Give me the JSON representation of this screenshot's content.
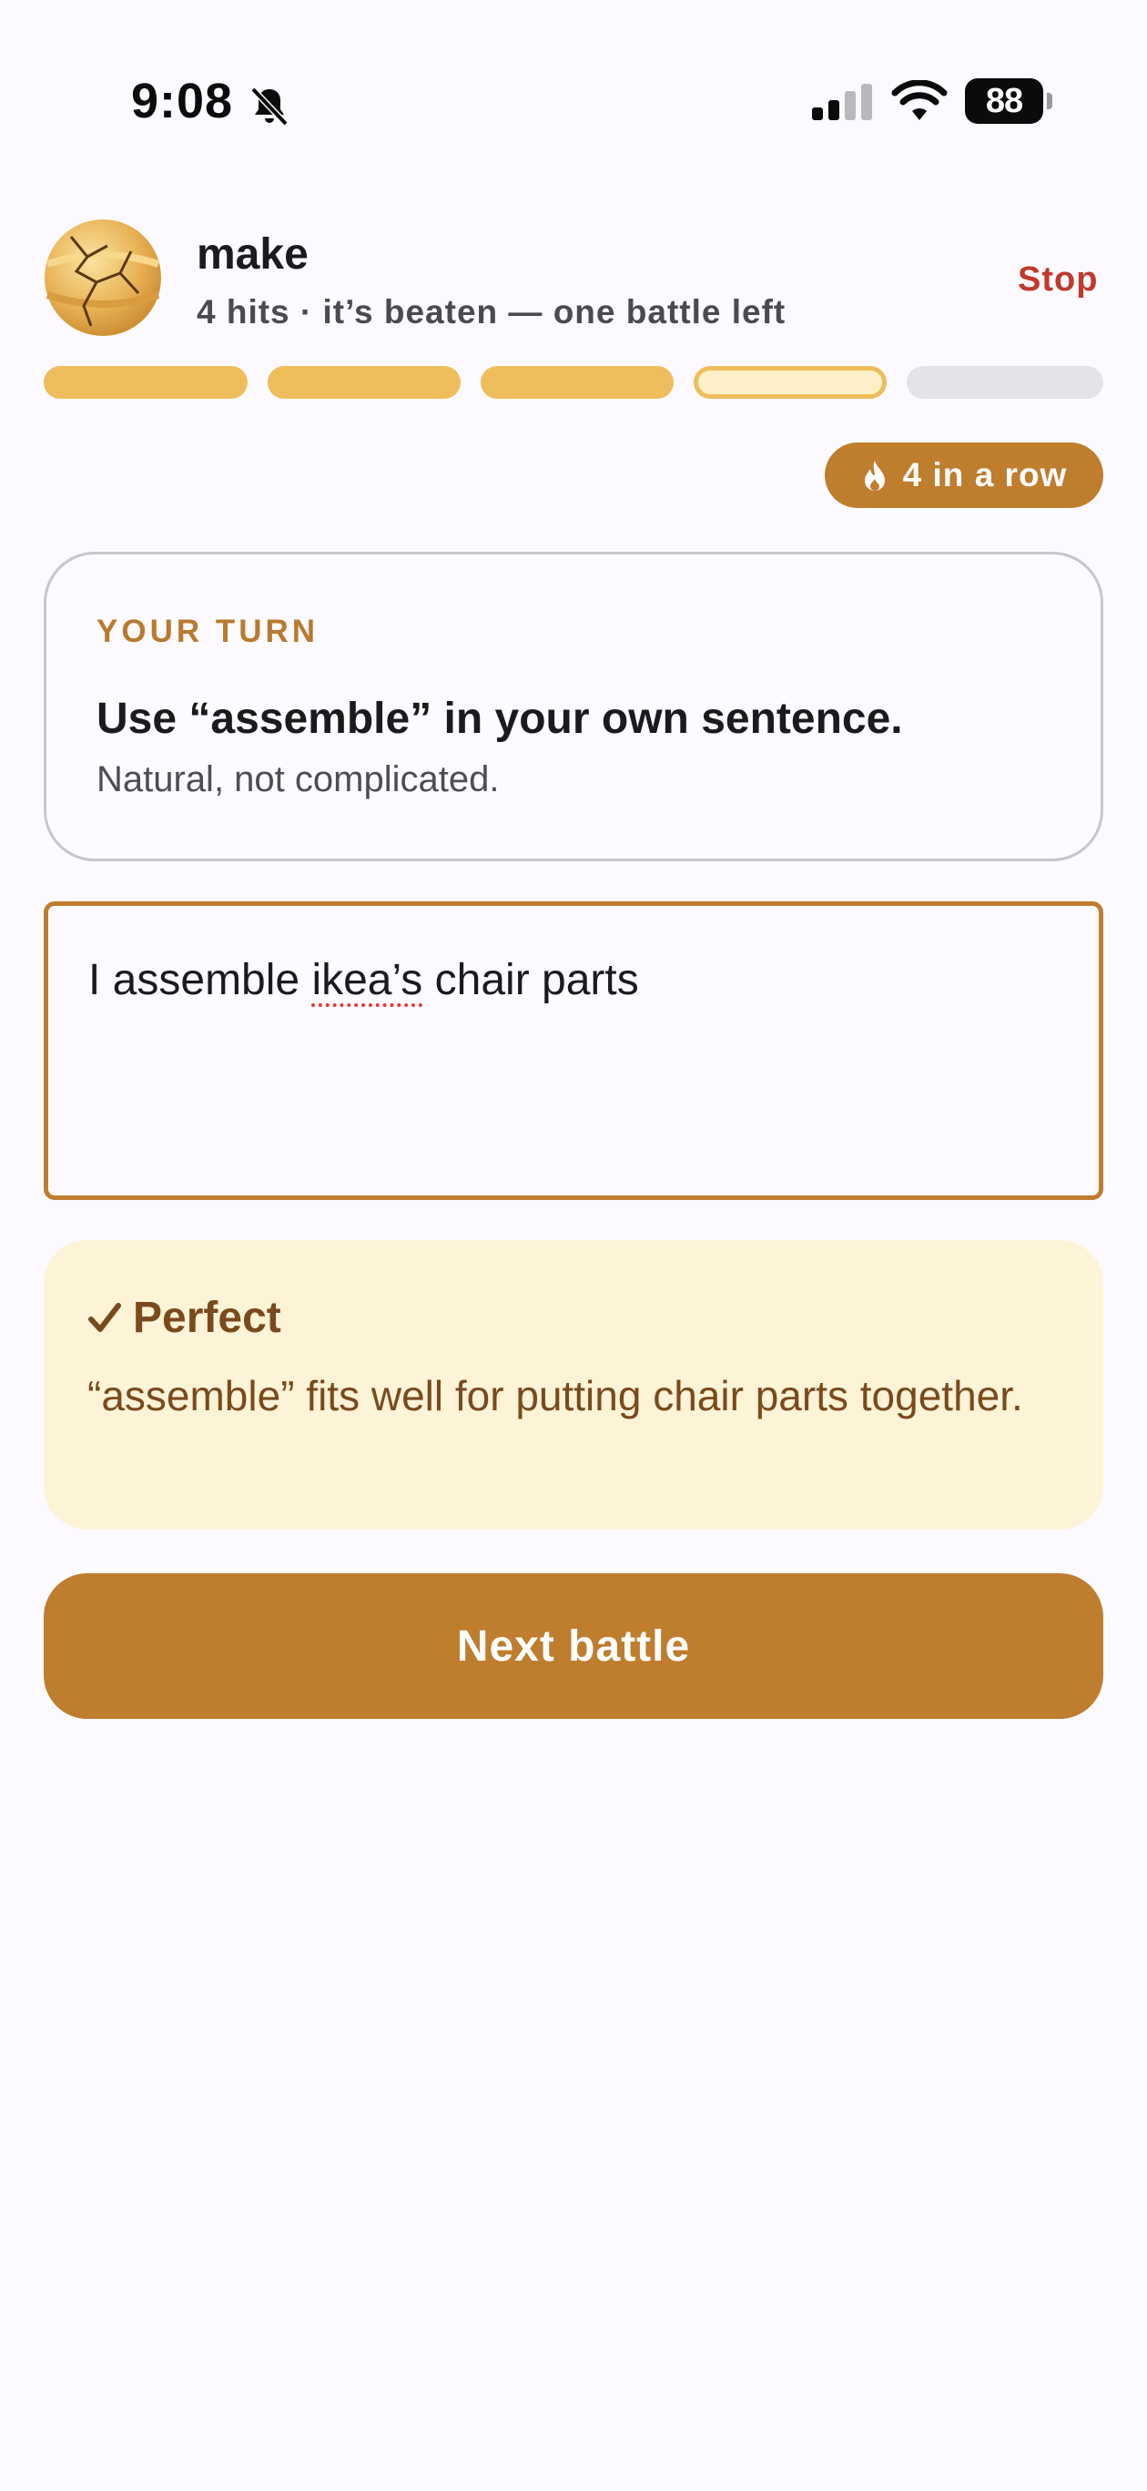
{
  "status_bar": {
    "time": "9:08",
    "battery": "88",
    "icons": [
      "bell-slash-icon",
      "cellular-signal-icon",
      "wifi-icon",
      "battery-icon"
    ]
  },
  "header": {
    "word": "make",
    "subtitle": "4 hits · it’s beaten — one battle left",
    "stop_label": "Stop",
    "avatar_icon": "cracked-orb-icon"
  },
  "progress": {
    "segments": [
      "done",
      "done",
      "done",
      "current",
      "todo"
    ]
  },
  "streak": {
    "icon": "flame-icon",
    "label": "4 in a row"
  },
  "prompt": {
    "eyebrow": "YOUR TURN",
    "instruction": "Use “assemble” in your own sentence.",
    "hint": "Natural, not complicated."
  },
  "answer": {
    "before": "I assemble ",
    "misspelled": "ikea’s",
    "after": " chair parts"
  },
  "feedback": {
    "icon": "checkmark-icon",
    "title": "Perfect",
    "body": "“assemble” fits well for putting chair parts together."
  },
  "next_button": {
    "label": "Next battle"
  },
  "colors": {
    "accent": "#bf7d2e",
    "progress_done": "#efbe5c",
    "progress_todo": "#e3e3ea",
    "stop": "#c0392b",
    "feedback_bg": "#fdf3d7",
    "feedback_text": "#7a4a1c"
  }
}
